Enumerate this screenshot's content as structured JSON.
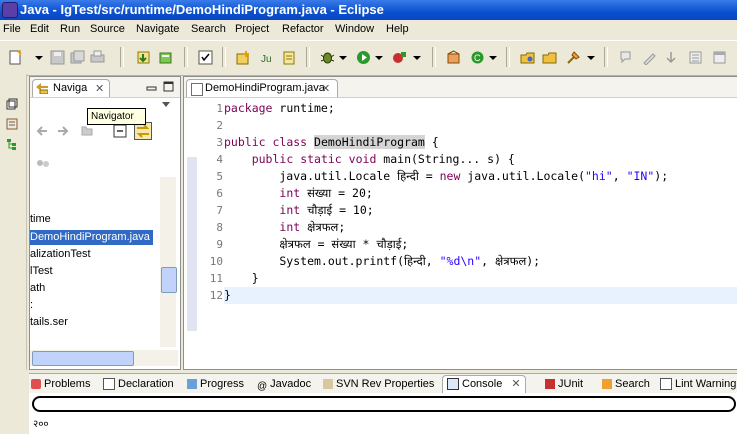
{
  "window": {
    "title": "Java - IgTest/src/runtime/DemoHindiProgram.java - Eclipse"
  },
  "menu": [
    "File",
    "Edit",
    "Run",
    "Source",
    "Navigate",
    "Search",
    "Project",
    "Refactor",
    "Window",
    "Help"
  ],
  "navigator": {
    "tab_label": "Naviga",
    "tooltip": "Navigator",
    "close": "✕",
    "items": [
      "time",
      "DemoHindiProgram.java",
      "alizationTest",
      "lTest",
      "ath",
      ":",
      "tails.ser"
    ],
    "selected_index": 1
  },
  "editor": {
    "tab_label": "DemoHindiProgram.java",
    "close": "✕",
    "line_numbers": [
      "1",
      "2",
      "3",
      "4",
      "5",
      "6",
      "7",
      "8",
      "9",
      "10",
      "11",
      "12"
    ],
    "lines": [
      "package runtime;",
      "",
      "public class DemoHindiProgram {",
      "    public static void main(String... s) {",
      "        java.util.Locale हिन्दी = new java.util.Locale(\"hi\", \"IN\");",
      "        int संख्या = 20;",
      "        int चौड़ाई = 10;",
      "        int क्षेत्रफल;",
      "        क्षेत्रफल = संख्या * चौड़ाई;",
      "        System.out.printf(हिन्दी, \"%d\\n\", क्षेत्रफल);",
      "    }",
      "}"
    ]
  },
  "bottom_tabs": [
    "Problems",
    "Declaration",
    "Progress",
    "Javadoc",
    "SVN Rev Properties",
    "Console",
    "JUnit",
    "Search",
    "Lint Warning"
  ],
  "console": {
    "output": "२००",
    "close": "✕"
  },
  "colors": {
    "titlebar": "#0a50d0",
    "selection": "#316ac5",
    "keyword": "#7f0055",
    "string": "#2a00ff"
  }
}
